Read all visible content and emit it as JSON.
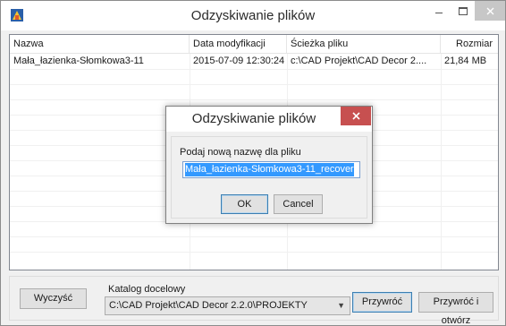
{
  "main_window": {
    "title": "Odzyskiwanie plików",
    "icons": {
      "app": "app-icon",
      "minimize": "minimize-icon",
      "maximize": "maximize-icon",
      "close": "close-icon"
    }
  },
  "file_list": {
    "columns": [
      "Nazwa",
      "Data modyfikacji",
      "Ścieżka pliku",
      "Rozmiar"
    ],
    "rows": [
      {
        "name": "Mała_łazienka-Słomkowa3-11",
        "modified": "2015-07-09 12:30:24",
        "path": "c:\\CAD Projekt\\CAD Decor 2....",
        "size": "21,84 MB"
      }
    ]
  },
  "bottom_bar": {
    "clear_label": "Wyczyść",
    "target_dir_label": "Katalog docelowy",
    "target_dir_value": "C:\\CAD Projekt\\CAD Decor 2.2.0\\PROJEKTY",
    "restore_label": "Przywróć",
    "restore_open_label": "Przywróć i otwórz"
  },
  "rename_dialog": {
    "title": "Odzyskiwanie plików",
    "prompt": "Podaj nową nazwę dla pliku",
    "input_value": "Mała_łazienka-Słomkowa3-11_recover",
    "ok_label": "OK",
    "cancel_label": "Cancel"
  },
  "colors": {
    "accent_blue": "#3399ff",
    "dialog_close_red": "#c75050",
    "window_bg": "#f0f0f0"
  }
}
